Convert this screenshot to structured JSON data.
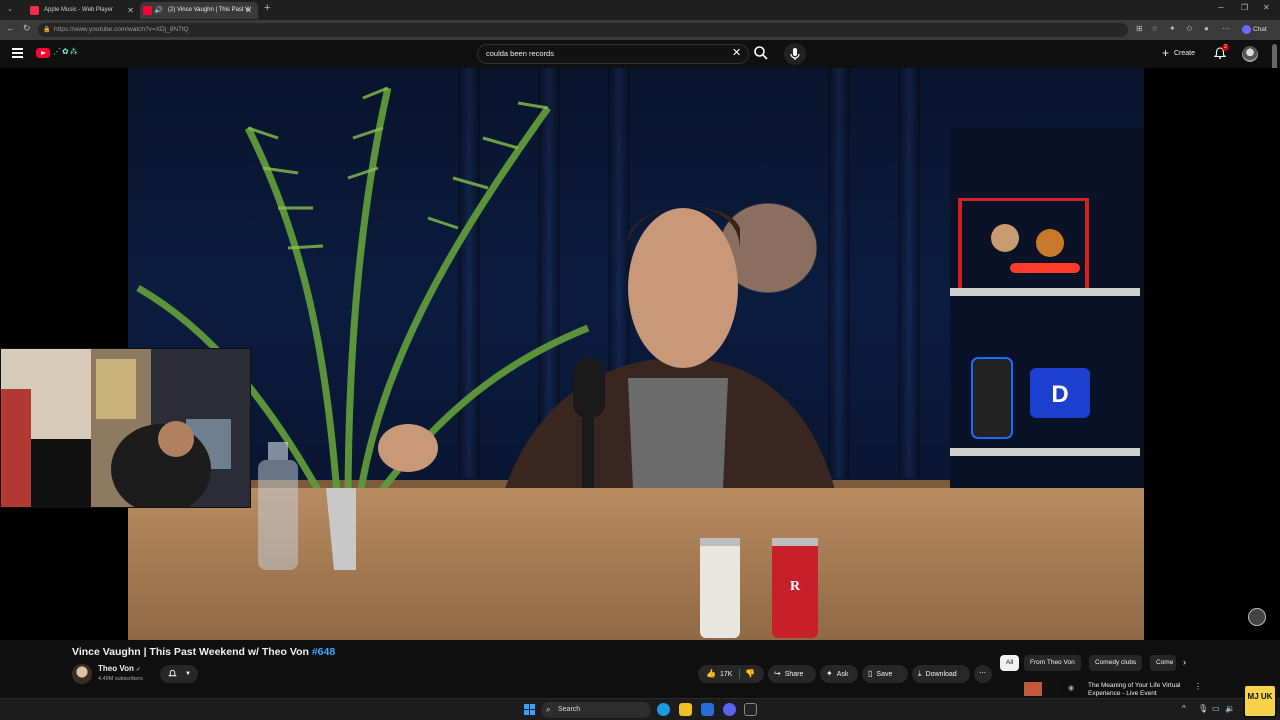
{
  "browser": {
    "tabs": [
      {
        "title": "Apple Music - Web Player",
        "favicon_color": "#fa2d48"
      },
      {
        "title": "(2) Vince Vaughn | This Past W",
        "favicon_color": "#ff0033"
      }
    ],
    "url": "https://www.youtube.com/watch?v=XDj_8N7tQ",
    "chat_label": "Chat"
  },
  "youtube": {
    "search_value": "coulda been records",
    "create_label": "Create",
    "notification_count": "2"
  },
  "video": {
    "title": "Vince Vaughn | This Past Weekend w/ Theo Von ",
    "episode_tag": "#648",
    "channel_name": "Theo Von",
    "subscribers": "4.49M subscribers",
    "subscribe_bell": "🔔"
  },
  "actions": {
    "like_count": "17K",
    "share": "Share",
    "ask": "Ask",
    "save": "Save",
    "download": "Download"
  },
  "chips": [
    "All",
    "From Theo Von",
    "Comedy clubs",
    "Come"
  ],
  "related": {
    "title": "The Meaning of Your Life Virtual Experience - Live Event"
  },
  "taskbar": {
    "search_placeholder": "Search"
  },
  "corner_logo_text": "MJ UK"
}
